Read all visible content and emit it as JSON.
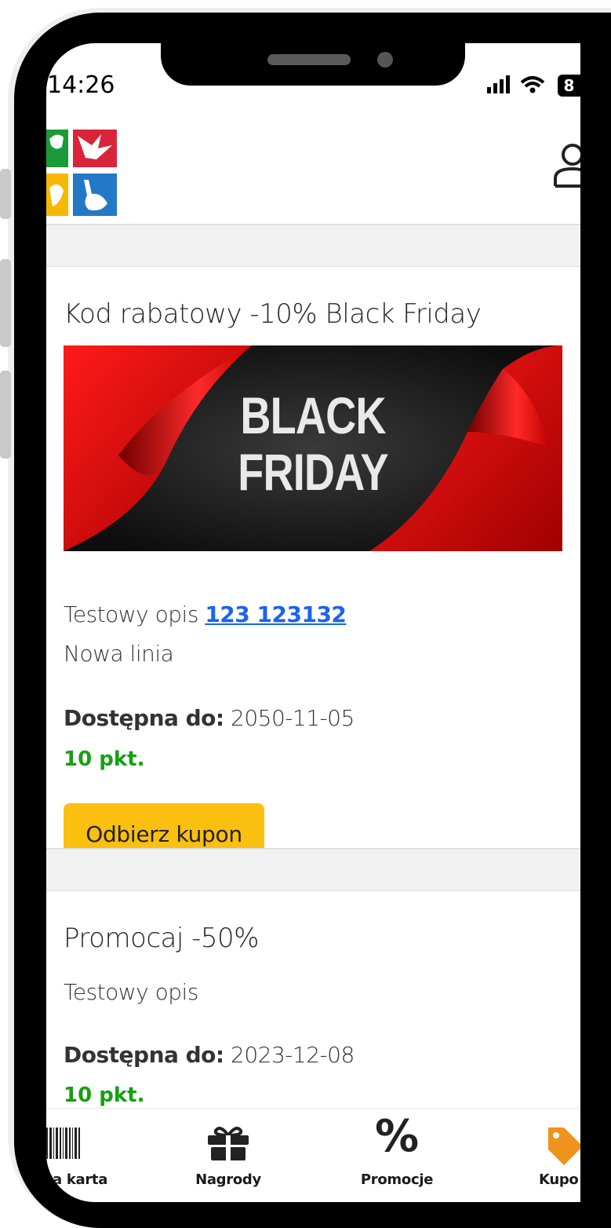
{
  "status_bar": {
    "time": "14:26",
    "battery": "8"
  },
  "header": {
    "logo_icon": "animals-logo-icon",
    "profile_icon": "user-icon"
  },
  "coupons": [
    {
      "title": "Kod rabatowy -10% Black Friday",
      "banner_line1": "BLACK",
      "banner_line2": "FRIDAY",
      "description_text": "Testowy opis ",
      "description_link": "123 123132",
      "description_line2": "Nowa linia",
      "available_label": "Dostępna do:",
      "available_date": "2050-11-05",
      "points": "10 pkt.",
      "button_label": "Odbierz kupon"
    },
    {
      "title": "Promocaj -50%",
      "description_text": "Testowy opis",
      "available_label": "Dostępna do:",
      "available_date": "2023-12-08",
      "points": "10 pkt."
    }
  ],
  "tab_bar": {
    "tabs": [
      {
        "label": "a karta",
        "icon": "barcode-icon"
      },
      {
        "label": "Nagrody",
        "icon": "gift-icon"
      },
      {
        "label": "Promocje",
        "icon": "percent-icon"
      },
      {
        "label": "Kupo",
        "icon": "tag-icon",
        "active": true
      }
    ]
  },
  "colors": {
    "accent_button": "#fbbf10",
    "points_green": "#16a012",
    "link_blue": "#1a63f0",
    "active_tab_orange": "#f0921e"
  }
}
